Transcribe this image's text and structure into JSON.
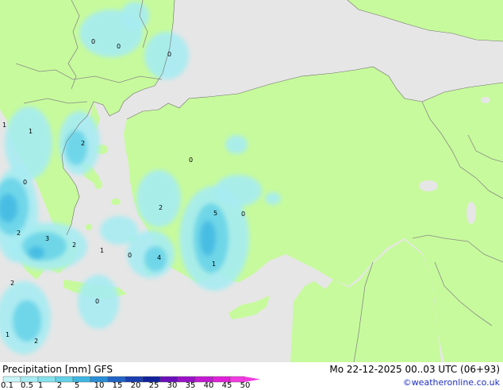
{
  "map": {
    "colors": {
      "sea": "#e6e6e6",
      "land": "#c7fa9c",
      "border": "#8a8a8a"
    },
    "precip_labels": [
      "0",
      "0",
      "0",
      "1",
      "1",
      "2",
      "0",
      "0",
      "2",
      "2",
      "3",
      "2",
      "1",
      "0",
      "4",
      "5",
      "0",
      "1",
      "2",
      "0",
      "1",
      "2"
    ]
  },
  "footer": {
    "title": "Precipitation [mm] GFS",
    "datetime": "Mo 22-12-2025 00..03 UTC (06+93)",
    "credit": "©weatheronline.co.uk"
  },
  "legend": {
    "ticks": [
      "0.1",
      "0.5",
      "1",
      "2",
      "5",
      "10",
      "15",
      "20",
      "25",
      "30",
      "35",
      "40",
      "45",
      "50"
    ],
    "colors": [
      "#c8f5f8",
      "#a6ecf2",
      "#86e2ec",
      "#64d2e8",
      "#3fb6e2",
      "#2b8fd6",
      "#2165c6",
      "#1a3fb0",
      "#12229a",
      "#6a10b8",
      "#9a12c8",
      "#c21ad2",
      "#e020d8",
      "#f23ae0"
    ]
  }
}
